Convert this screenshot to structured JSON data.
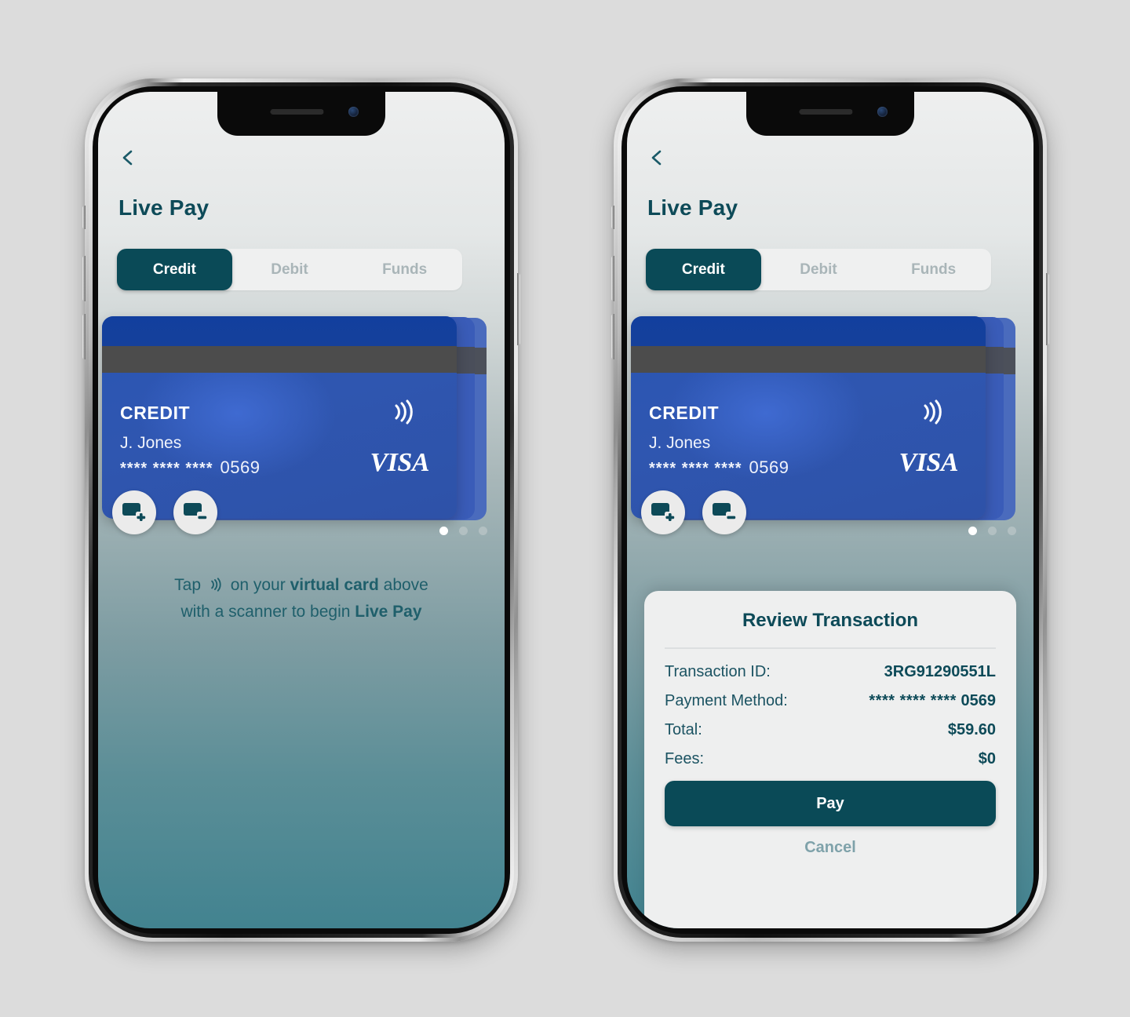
{
  "app": {
    "title": "Live Pay",
    "back_icon": "chevron-left-icon",
    "tabs": [
      {
        "label": "Credit",
        "active": true
      },
      {
        "label": "Debit",
        "active": false
      },
      {
        "label": "Funds",
        "active": false
      }
    ]
  },
  "card": {
    "type_label": "CREDIT",
    "holder": "J. Jones",
    "number_masked": "**** **** ****",
    "number_last4": "0569",
    "network": "VISA",
    "nfc_icon": "contactless-icon",
    "add_icon": "add-card-icon",
    "remove_icon": "remove-card-icon",
    "dots_total": 3,
    "dots_active_index": 0
  },
  "hint": {
    "line1_pre": "Tap",
    "nfc_icon": "contactless-icon",
    "line1_mid": "on your",
    "line1_bold": "virtual card",
    "line1_post": "above",
    "line2_pre": "with a scanner to begin",
    "line2_bold": "Live Pay"
  },
  "review": {
    "title": "Review Transaction",
    "rows": [
      {
        "key": "Transaction ID:",
        "value": "3RG91290551L",
        "masked": ""
      },
      {
        "key": "Payment Method:",
        "value": "0569",
        "masked": "**** **** ****"
      },
      {
        "key": "Total:",
        "value": "$59.60",
        "masked": ""
      },
      {
        "key": "Fees:",
        "value": "$0",
        "masked": ""
      }
    ],
    "pay_label": "Pay",
    "cancel_label": "Cancel"
  },
  "colors": {
    "brand_teal": "#0a4a57",
    "title_teal": "#0d4a58",
    "card_blue": "#2f56b0",
    "inactive_tab": "#a9b5b8",
    "cancel_text": "#7fa2aa"
  }
}
